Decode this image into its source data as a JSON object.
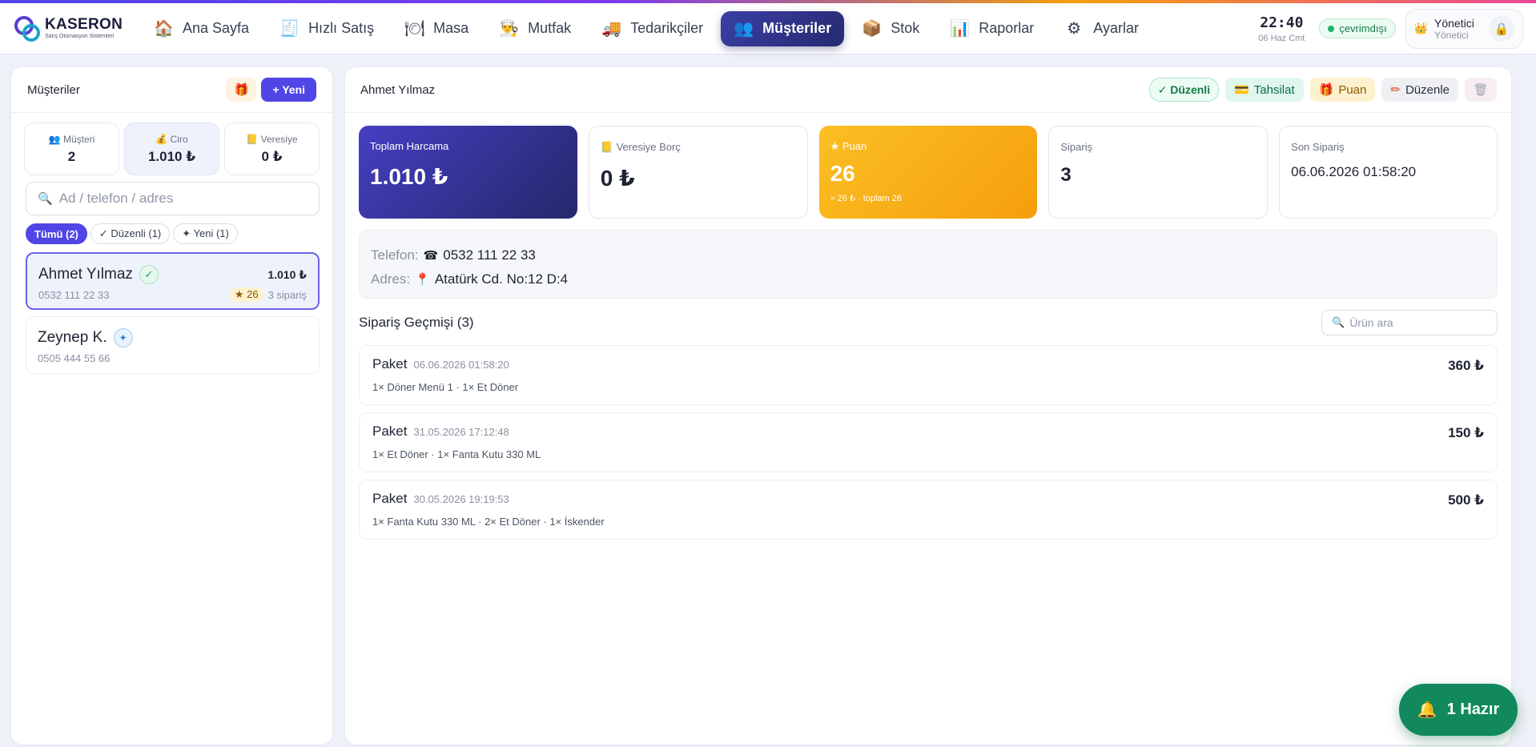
{
  "app": {
    "logo_name": "KASERON",
    "logo_tagline": "Satış Otomasyon Sistemleri"
  },
  "nav": {
    "items": [
      {
        "label": "Ana Sayfa",
        "icon": "house-icon",
        "glyph": "🏠"
      },
      {
        "label": "Hızlı Satış",
        "icon": "register-icon",
        "glyph": "🧾"
      },
      {
        "label": "Masa",
        "icon": "plate-icon",
        "glyph": "🍽"
      },
      {
        "label": "Mutfak",
        "icon": "chef-icon",
        "glyph": "👨‍🍳"
      },
      {
        "label": "Tedarikçiler",
        "icon": "truck-icon",
        "glyph": "🚚"
      },
      {
        "label": "Müşteriler",
        "icon": "people-icon",
        "glyph": "👥",
        "active": true
      },
      {
        "label": "Stok",
        "icon": "box-icon",
        "glyph": "📦"
      },
      {
        "label": "Raporlar",
        "icon": "chart-icon",
        "glyph": "📊"
      },
      {
        "label": "Ayarlar",
        "icon": "gear-icon",
        "glyph": "⚙"
      }
    ],
    "clock_time": "22:40",
    "clock_date": "06 Haz Cmt",
    "status": "çevrimdışı",
    "user_name": "Yönetici",
    "user_role": "Yönetici",
    "user_icon": "👑",
    "lock_icon": "🔒"
  },
  "left": {
    "title": "Müşteriler",
    "gift_icon": "🎁",
    "new_label": "+ Yeni",
    "stats": [
      {
        "icon": "👥",
        "label": "Müşteri",
        "value": "2"
      },
      {
        "icon": "💰",
        "label": "Ciro",
        "value": "1.010 ₺"
      },
      {
        "icon": "📒",
        "label": "Veresiye",
        "value": "0 ₺"
      }
    ],
    "search_icon": "🔍",
    "search_placeholder": "Ad / telefon / adres",
    "filters": [
      {
        "label": "Tümü (2)",
        "active": true
      },
      {
        "label": "✓ Düzenli (1)"
      },
      {
        "label": "✦ Yeni (1)"
      }
    ],
    "customers": [
      {
        "name": "Ahmet Yılmaz",
        "badge": "✓",
        "phone": "0532 111 22 33",
        "total": "1.010 ₺",
        "points": "★ 26",
        "orders": "3 sipariş"
      },
      {
        "name": "Zeynep K.",
        "badge": "✦",
        "phone": "0505 444 55 66"
      }
    ]
  },
  "detail": {
    "title": "Ahmet Yılmaz",
    "actions": {
      "regular": "✓ Düzenli",
      "payment": "Tahsilat",
      "payment_icon": "💳",
      "points": "Puan",
      "points_icon": "🎁",
      "edit": "Düzenle",
      "edit_icon": "✏",
      "delete_icon": "🗑"
    },
    "cards": {
      "spend_label": "Toplam Harcama",
      "spend_value": "1.010 ₺",
      "debt_icon": "📒",
      "debt_label": "Veresiye Borç",
      "debt_value": "0 ₺",
      "points_label": "★ Puan",
      "points_value": "26",
      "points_sub": "≈ 26 ₺ · toplam 26",
      "orders_label": "Sipariş",
      "orders_value": "3",
      "last_label": "Son Sipariş",
      "last_value": "06.06.2026 01:58:20"
    },
    "info": {
      "phone_label": "Telefon:",
      "phone_icon": "☎",
      "phone": "0532 111 22 33",
      "address_label": "Adres:",
      "address_icon": "📍",
      "address": "Atatürk Cd. No:12 D:4"
    },
    "history": {
      "title": "Sipariş Geçmişi (3)",
      "search_icon": "🔍",
      "search_placeholder": "Ürün ara",
      "orders": [
        {
          "type": "Paket",
          "date": "06.06.2026 01:58:20",
          "items": "1× Döner Menü 1 · 1× Et Döner",
          "total": "360 ₺"
        },
        {
          "type": "Paket",
          "date": "31.05.2026 17:12:48",
          "items": "1× Et Döner · 1× Fanta Kutu 330 ML",
          "total": "150 ₺"
        },
        {
          "type": "Paket",
          "date": "30.05.2026 19:19:53",
          "items": "1× Fanta Kutu 330 ML · 2× Et Döner · 1× İskender",
          "total": "500 ₺"
        }
      ]
    }
  },
  "ready": {
    "icon": "🔔",
    "label": "1 Hazır"
  }
}
